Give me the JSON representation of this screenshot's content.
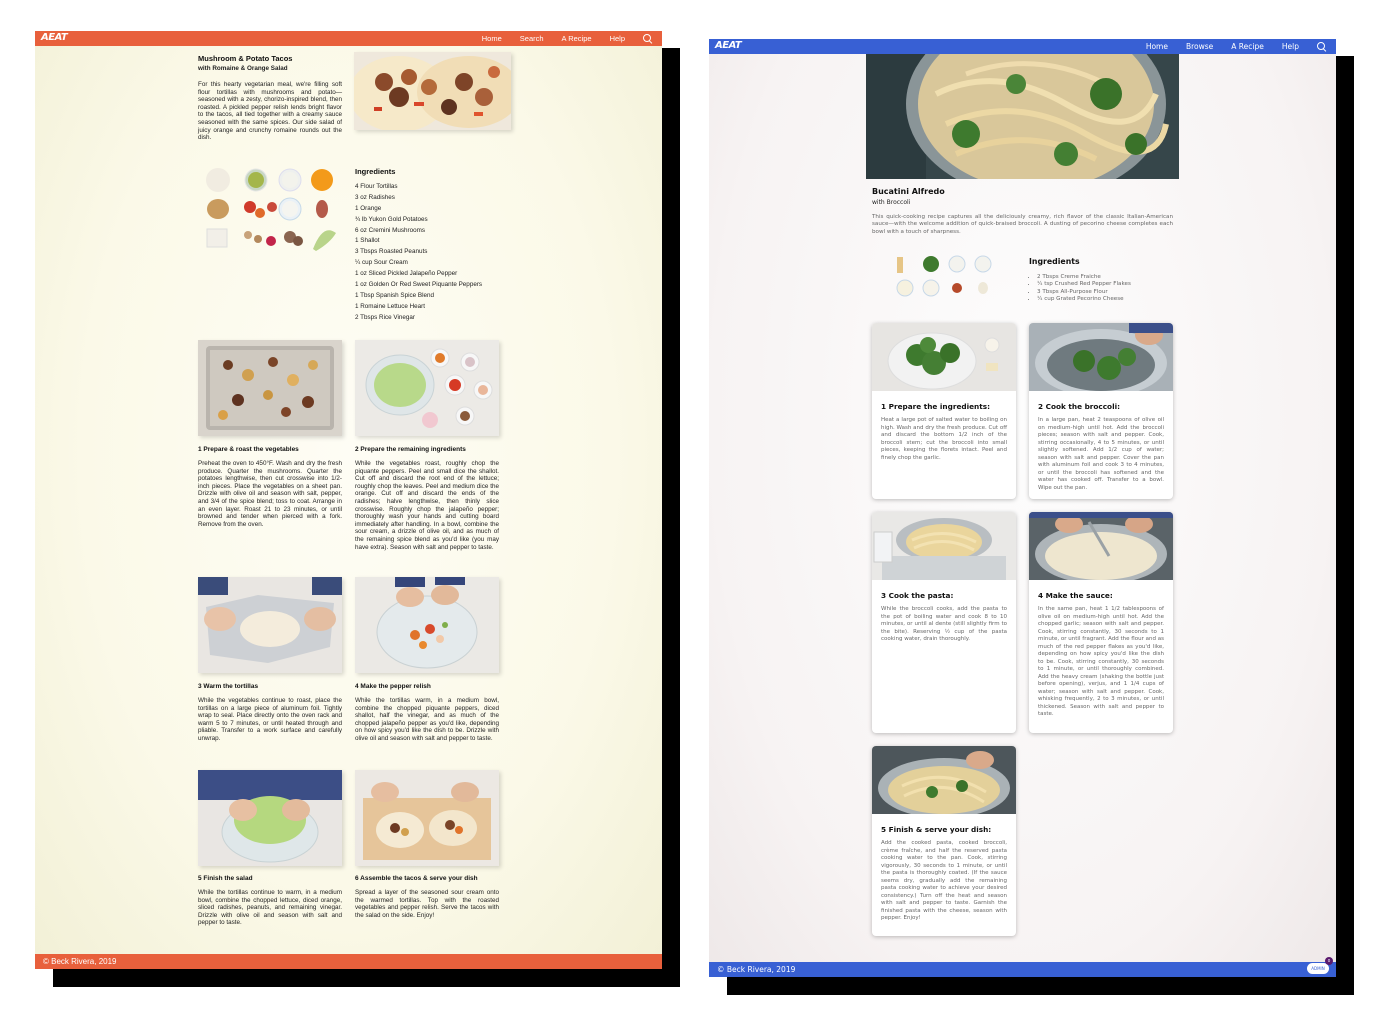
{
  "left": {
    "nav": {
      "logo": "AEAT",
      "links": [
        "Home",
        "Search",
        "A Recipe",
        "Help"
      ]
    },
    "recipe": {
      "title": "Mushroom & Potato Tacos",
      "subtitle": "with Romaine & Orange Salad",
      "description": "For this hearty vegetarian meal, we're filling soft flour tortillas with mushrooms and potato—seasoned with a zesty, chorizo-inspired blend, then roasted. A pickled pepper relish lends bright flavor to the tacos, all tied together with a creamy sauce seasoned with the same spices. Our side salad of juicy orange and crunchy romaine rounds out the dish."
    },
    "ingredients_heading": "Ingredients",
    "ingredients": [
      "4 Flour Tortillas",
      "3 oz Radishes",
      "1 Orange",
      "¾ lb Yukon Gold Potatoes",
      "6 oz Cremini Mushrooms",
      "1 Shallot",
      "3 Tbsps Roasted Peanuts",
      "¼ cup Sour Cream",
      "1 oz Sliced Pickled Jalapeño Pepper",
      "1 oz Golden Or Red Sweet Piquante Peppers",
      "1 Tbsp Spanish Spice Blend",
      "1 Romaine Lettuce Heart",
      "2 Tbsps Rice Vinegar"
    ],
    "steps": [
      {
        "title": "1 Prepare & roast the vegetables",
        "text": "Preheat the oven to 450°F. Wash and dry the fresh produce. Quarter the mushrooms. Quarter the potatoes lengthwise, then cut crosswise into 1/2- inch pieces. Place the vegetables on a sheet pan. Drizzle with olive oil and season with salt, pepper, and 3/4 of the spice blend; toss to coat. Arrange in an even layer. Roast 21 to 23 minutes, or until browned and tender when pierced with a fork. Remove from the oven."
      },
      {
        "title": "2 Prepare the remaining ingredients",
        "text": "While the vegetables roast, roughly chop the piquante peppers. Peel and small dice the shallot. Cut off and discard the root end of the lettuce; roughly chop the leaves. Peel and medium dice the orange. Cut off and discard the ends of the radishes; halve lengthwise, then thinly slice crosswise. Roughly chop the jalapeño pepper; thoroughly wash your hands and cutting board immediately after handling. In a bowl, combine the sour cream, a drizzle of olive oil, and as much of the remaining spice blend as you'd like (you may have extra). Season with salt and pepper to taste."
      },
      {
        "title": "3 Warm the tortillas",
        "text": "While the vegetables continue to roast, place the tortillas on a large piece of aluminum foil. Tightly wrap to seal. Place directly onto the oven rack and warm 5 to 7 minutes, or until heated through and pliable. Transfer to a work surface and carefully unwrap."
      },
      {
        "title": "4 Make the pepper relish",
        "text": "While the tortillas warm, in a medium bowl, combine the chopped piquante peppers, diced shallot, half the vinegar, and as much of the chopped jalapeño pepper as you'd like, depending on how spicy you'd like the dish to be. Drizzle with olive oil and season with salt and pepper to taste."
      },
      {
        "title": "5 Finish the salad",
        "text": "While the tortillas continue to warm, in a medium bowl, combine the chopped lettuce, diced orange, sliced radishes, peanuts, and remaining vinegar. Drizzle with olive oil and season with salt and pepper to taste."
      },
      {
        "title": "6 Assemble the tacos & serve your dish",
        "text": "Spread a layer of the seasoned sour cream onto the warmed tortillas. Top with the roasted vegetables and pepper relish. Serve the tacos with the salad on the side. Enjoy!"
      }
    ],
    "footer": "© Beck Rivera, 2019"
  },
  "right": {
    "nav": {
      "logo": "AEAT",
      "links": [
        "Home",
        "Browse",
        "A Recipe",
        "Help"
      ]
    },
    "recipe": {
      "title": "Bucatini Alfredo",
      "subtitle": "with Broccoli",
      "description": "This quick-cooking recipe captures all the deliciously creamy, rich flavor of the classic Italian-American sauce—with the welcome addition of quick-braised broccoli. A dusting of pecorino cheese completes each bowl with a touch of sharpness."
    },
    "ingredients_heading": "Ingredients",
    "ingredients": [
      "2 Tbsps Creme Fraiche",
      "¼ tsp Crushed Red Pepper Flakes",
      "3 Tbsps All-Purpose Flour",
      "¼ cup Grated Pecorino Cheese"
    ],
    "steps": [
      {
        "title": "1 Prepare the ingredients:",
        "text": "Heat a large pot of salted water to boiling on high. Wash and dry the fresh produce. Cut off and discard the bottom 1/2 inch of the broccoli stem; cut the broccoli into small pieces, keeping the florets intact. Peel and finely chop the garlic."
      },
      {
        "title": "2 Cook the broccoli:",
        "text": "In a large pan, heat 2 teaspoons of olive oil on medium-high until hot. Add the broccoli pieces; season with salt and pepper. Cook, stirring occasionally, 4 to 5 minutes, or until slightly softened. Add 1/2 cup of water; season with salt and pepper. Cover the pan with aluminum foil and cook 3 to 4 minutes, or until the broccoli has softened and the water has cooked off. Transfer to a bowl. Wipe out the pan."
      },
      {
        "title": "3 Cook the pasta:",
        "text": "While the broccoli cooks, add the pasta to the pot of boiling water and cook 8 to 10 minutes, or until al dente (still slightly firm to the bite). Reserving ½ cup of the pasta cooking water, drain thoroughly."
      },
      {
        "title": "4 Make the sauce:",
        "text": "In the same pan, heat 1 1/2 tablespoons of olive oil on medium-high until hot. Add the chopped garlic; season with salt and pepper. Cook, stirring constantly, 30 seconds to 1 minute, or until fragrant. Add the flour and as much of the red pepper flakes as you'd like, depending on how spicy you'd like the dish to be. Cook, stirring constantly, 30 seconds to 1 minute, or until thoroughly combined. Add the heavy cream (shaking the bottle just before opening), verjus, and 1 1/4 cups of water; season with salt and pepper. Cook, whisking frequently, 2 to 3 minutes, or until thickened. Season with salt and pepper to taste."
      },
      {
        "title": "5 Finish & serve your dish:",
        "text": "Add the cooked pasta, cooked broccoli, crème fraîche, and half the reserved pasta cooking water to the pan. Cook, stirring vigorously, 30 seconds to 1 minute, or until the pasta is thoroughly coated. (If the sauce seems dry, gradually add the remaining pasta cooking water to achieve your desired consistency.) Turn off the heat and season with salt and pepper to taste. Garnish the finished pasta with the cheese, season with pepper. Enjoy!"
      }
    ],
    "footer": "© Beck Rivera, 2019",
    "admin_label": "ADMIN",
    "badge": "0"
  },
  "colors": {
    "left_accent": "#e8603c",
    "right_accent": "#3860d4"
  }
}
